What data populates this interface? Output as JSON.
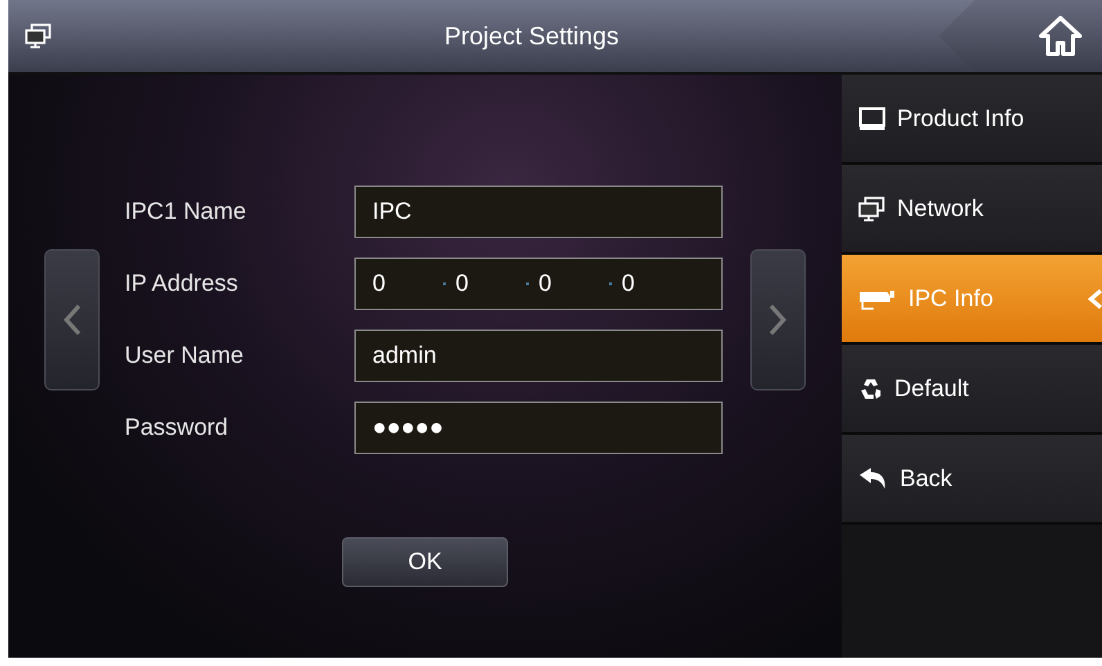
{
  "header": {
    "title": "Project Settings"
  },
  "form": {
    "fields": [
      {
        "kind": "text",
        "label": "IPC1 Name",
        "value": "IPC"
      },
      {
        "kind": "ip",
        "label": "IP Address",
        "octets": [
          "0",
          "0",
          "0",
          "0"
        ]
      },
      {
        "kind": "text",
        "label": "User Name",
        "value": "admin"
      },
      {
        "kind": "password",
        "label": "Password",
        "value": "●●●●●"
      }
    ],
    "ok_button": "OK"
  },
  "sidebar": {
    "items": [
      {
        "label": "Product Info",
        "selected": false
      },
      {
        "label": "Network",
        "selected": false
      },
      {
        "label": "IPC Info",
        "selected": true
      },
      {
        "label": "Default",
        "selected": false
      },
      {
        "label": "Back",
        "selected": false
      }
    ]
  }
}
